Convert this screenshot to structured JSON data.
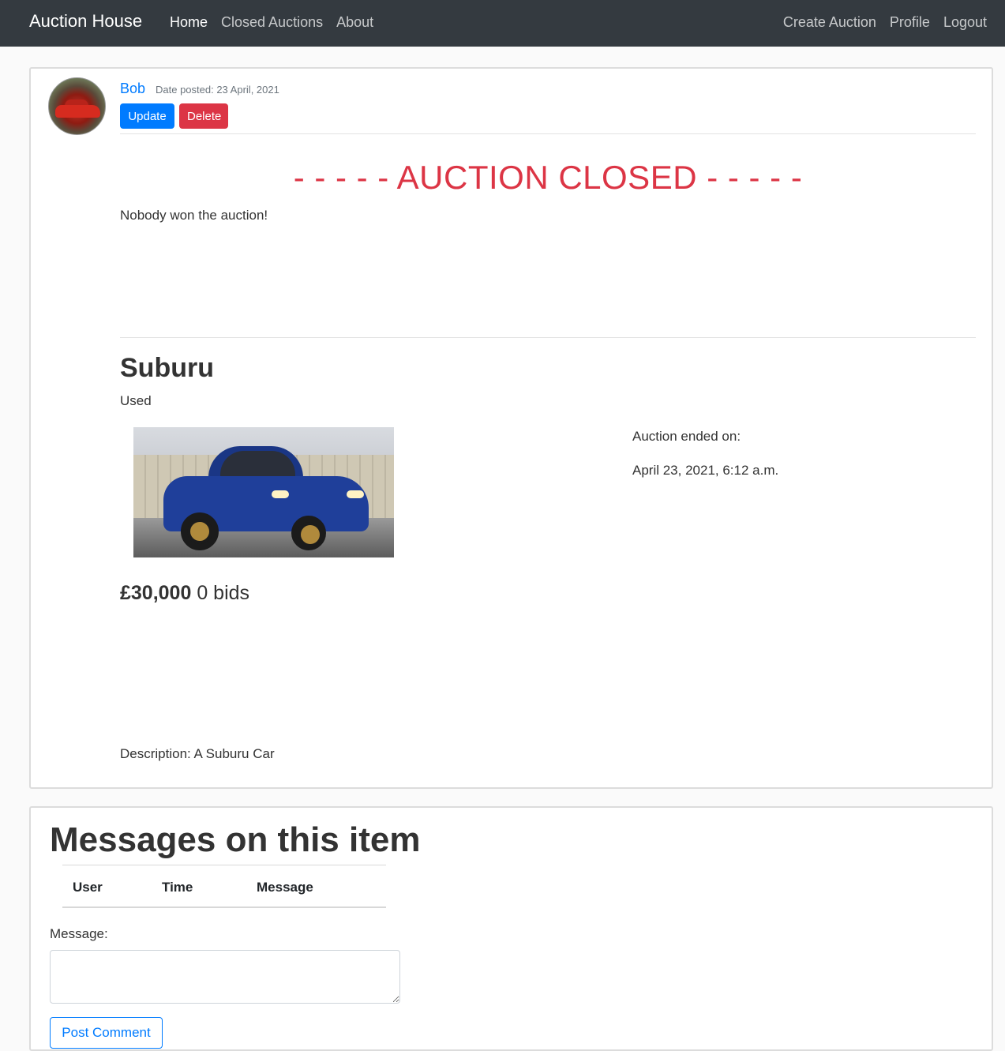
{
  "navbar": {
    "brand": "Auction House",
    "left_links": [
      "Home",
      "Closed Auctions",
      "About"
    ],
    "right_links": [
      "Create Auction",
      "Profile",
      "Logout"
    ],
    "active": "Home"
  },
  "post": {
    "author": "Bob",
    "date_posted": "Date posted: 23 April, 2021",
    "update_label": "Update",
    "delete_label": "Delete",
    "closed_banner": "- - - - - AUCTION CLOSED - - - - -",
    "winner_text": "Nobody won the auction!",
    "title": "Suburu",
    "condition": "Used",
    "end_label": "Auction ended on:",
    "end_date": "April 23, 2021, 6:12 a.m.",
    "price": "£30,000",
    "bids": "0 bids",
    "description": "Description: A Suburu Car"
  },
  "messages": {
    "title": "Messages on this item",
    "columns": [
      "User",
      "Time",
      "Message"
    ],
    "message_label": "Message:",
    "post_button": "Post Comment"
  },
  "colors": {
    "navbar_bg": "#343a40",
    "primary": "#007bff",
    "danger": "#dc3545"
  }
}
